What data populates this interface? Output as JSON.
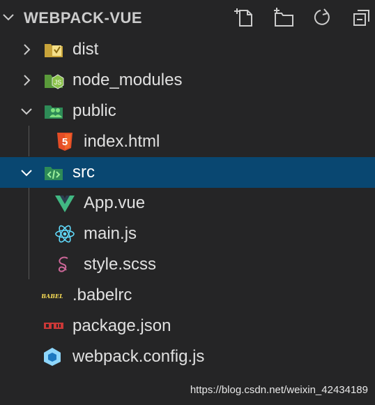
{
  "explorer": {
    "title": "WEBPACK-VUE",
    "toolbar": {
      "new_file_icon": "new-file-icon",
      "new_folder_icon": "new-folder-icon",
      "refresh_icon": "refresh-icon",
      "collapse_icon": "collapse-all-icon"
    }
  },
  "tree": [
    {
      "label": "dist",
      "type": "folder",
      "expanded": false,
      "icon": "dist-folder-icon"
    },
    {
      "label": "node_modules",
      "type": "folder",
      "expanded": false,
      "icon": "node-folder-icon"
    },
    {
      "label": "public",
      "type": "folder",
      "expanded": true,
      "icon": "public-folder-icon"
    },
    {
      "label": "index.html",
      "type": "file",
      "icon": "html5-icon"
    },
    {
      "label": "src",
      "type": "folder",
      "expanded": true,
      "icon": "src-folder-icon",
      "selected": true
    },
    {
      "label": "App.vue",
      "type": "file",
      "icon": "vue-icon"
    },
    {
      "label": "main.js",
      "type": "file",
      "icon": "react-icon"
    },
    {
      "label": "style.scss",
      "type": "file",
      "icon": "sass-icon"
    },
    {
      "label": ".babelrc",
      "type": "file",
      "icon": "babel-icon"
    },
    {
      "label": "package.json",
      "type": "file",
      "icon": "npm-icon"
    },
    {
      "label": "webpack.config.js",
      "type": "file",
      "icon": "webpack-icon"
    }
  ],
  "watermark": "https://blog.csdn.net/weixin_42434189",
  "colors": {
    "background": "#252526",
    "selection": "#094771",
    "text": "#e0e0e0"
  }
}
